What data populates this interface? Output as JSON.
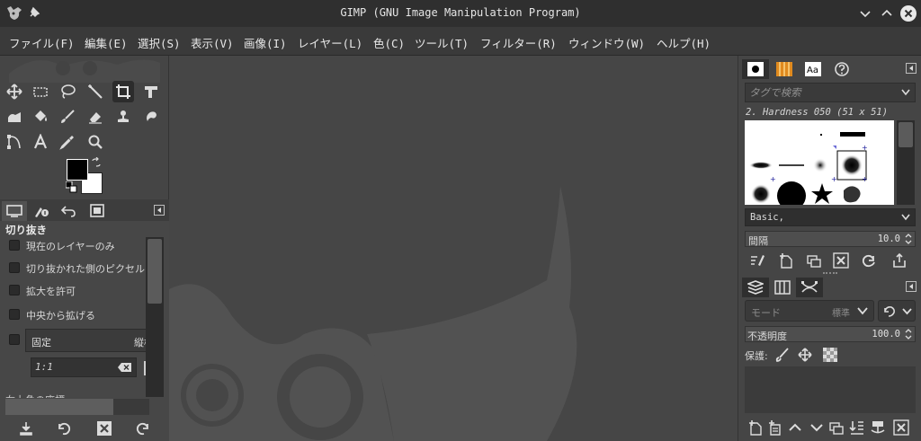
{
  "window": {
    "title": "GIMP (GNU Image Manipulation Program)"
  },
  "menu": [
    "ファイル(F)",
    "編集(E)",
    "選択(S)",
    "表示(V)",
    "画像(I)",
    "レイヤー(L)",
    "色(C)",
    "ツール(T)",
    "フィルター(R)",
    "ウィンドウ(W)",
    "ヘルプ(H)"
  ],
  "toolbox": {
    "tools": [
      {
        "name": "move-tool",
        "icon": "move-icon"
      },
      {
        "name": "rect-select-tool",
        "icon": "rect-select-icon"
      },
      {
        "name": "lasso-tool",
        "icon": "lasso-icon"
      },
      {
        "name": "fuzzy-select-tool",
        "icon": "wand-icon"
      },
      {
        "name": "crop-tool",
        "icon": "crop-icon",
        "active": true
      },
      {
        "name": "unified-transform-tool",
        "icon": "transform-icon"
      },
      {
        "name": "warp-tool",
        "icon": "warp-icon"
      },
      {
        "name": "bucket-fill-tool",
        "icon": "bucket-icon"
      },
      {
        "name": "paintbrush-tool",
        "icon": "brush-icon"
      },
      {
        "name": "eraser-tool",
        "icon": "eraser-icon"
      },
      {
        "name": "clone-tool",
        "icon": "stamp-icon"
      },
      {
        "name": "smudge-tool",
        "icon": "smudge-icon"
      },
      {
        "name": "paths-tool",
        "icon": "paths-icon"
      },
      {
        "name": "text-tool",
        "icon": "text-icon"
      },
      {
        "name": "color-picker-tool",
        "icon": "eyedropper-icon"
      },
      {
        "name": "zoom-tool",
        "icon": "zoom-icon"
      }
    ],
    "fg_color": "#000000",
    "bg_color": "#ffffff"
  },
  "tool_options": {
    "title": "切り抜き",
    "options": [
      "現在のレイヤーのみ",
      "切り抜かれた側のピクセル",
      "拡大を許可",
      "中央から拡げる"
    ],
    "fixed_label": "固定",
    "fixed_mode": "縦横",
    "ratio_value": "1:1",
    "cut_label": "右上角の座標",
    "progress": 0.75
  },
  "brushes": {
    "search_placeholder": "タグで検索",
    "current_brush": "2. Hardness 050 (51 x 51)",
    "tag_set": "Basic,",
    "spacing_label": "間隔",
    "spacing_value": "10.0"
  },
  "layers": {
    "mode_label": "モード",
    "mode_value": "標準",
    "opacity_label": "不透明度",
    "opacity_value": "100.0",
    "protect_label": "保護:"
  },
  "colors": {
    "window_bg": "#454545",
    "titlebar": "#2f2f2f",
    "menubar": "#3a3a3a"
  }
}
